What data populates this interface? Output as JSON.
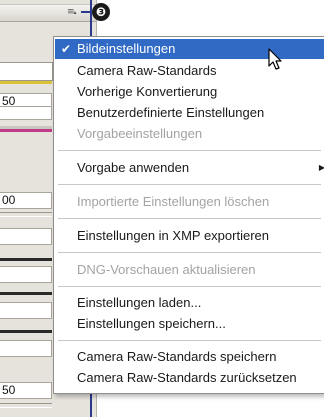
{
  "panel": {
    "fields": [
      "",
      "50",
      "",
      "00",
      "",
      "",
      "",
      "50"
    ],
    "flyout_icon": "panel-flyout-menu-icon",
    "dropdown_icon": "chevron-down-icon"
  },
  "callout": {
    "number": "❸"
  },
  "menu": {
    "items": [
      {
        "label": "Bildeinstellungen",
        "checked": true,
        "selected": true,
        "enabled": true
      },
      {
        "label": "Camera Raw-Standards",
        "enabled": true
      },
      {
        "label": "Vorherige Konvertierung",
        "enabled": true
      },
      {
        "label": "Benutzerdefinierte Einstellungen",
        "enabled": true
      },
      {
        "label": "Vorgabeeinstellungen",
        "enabled": false
      },
      {
        "label": "Vorgabe anwenden",
        "enabled": true,
        "submenu": true
      },
      {
        "label": "Importierte Einstellungen löschen",
        "enabled": false
      },
      {
        "label": "Einstellungen in XMP exportieren",
        "enabled": true
      },
      {
        "label": "DNG-Vorschauen aktualisieren",
        "enabled": false
      },
      {
        "label": "Einstellungen laden...",
        "enabled": true
      },
      {
        "label": "Einstellungen speichern...",
        "enabled": true
      },
      {
        "label": "Camera Raw-Standards speichern",
        "enabled": true
      },
      {
        "label": "Camera Raw-Standards zurücksetzen",
        "enabled": true
      }
    ],
    "checkmark": "✔",
    "submenu_arrow": "▶"
  },
  "colors": {
    "highlight": "#316ac5",
    "callout": "#2b3a8f"
  }
}
